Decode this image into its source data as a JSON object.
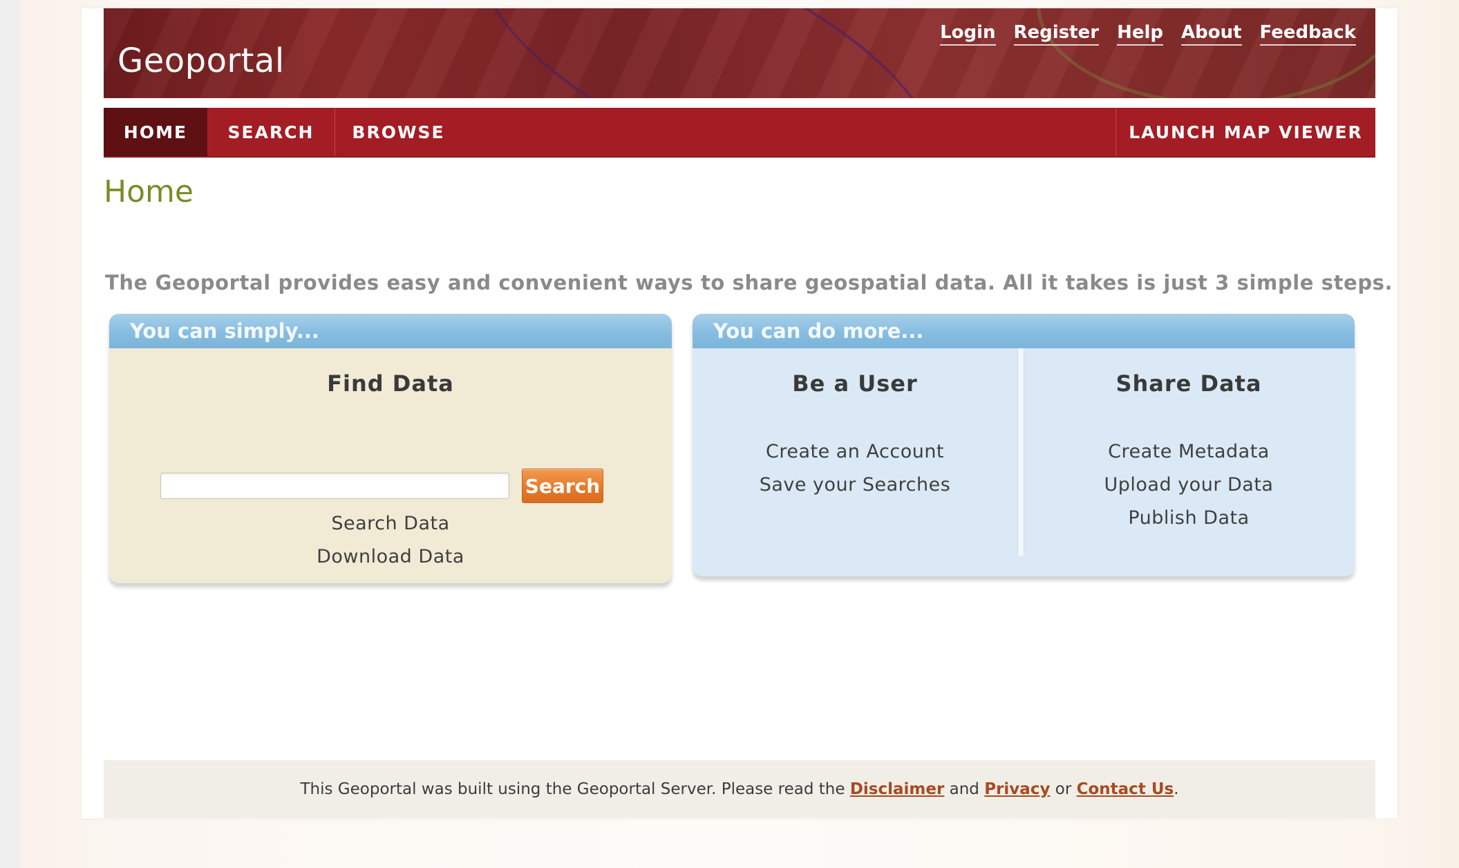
{
  "header": {
    "site_title": "Geoportal",
    "top_links": [
      "Login",
      "Register",
      "Help",
      "About",
      "Feedback"
    ]
  },
  "nav": {
    "home": "HOME",
    "search": "SEARCH",
    "browse": "BROWSE",
    "launch": "LAUNCH MAP VIEWER"
  },
  "page": {
    "title": "Home",
    "intro": "The Geoportal provides easy and convenient ways to share geospatial data. All it takes is just 3 simple steps."
  },
  "panel_left": {
    "header": "You can simply...",
    "find_title": "Find Data",
    "search_placeholder": "",
    "search_button": "Search",
    "links": [
      "Search Data",
      "Download Data"
    ]
  },
  "panel_right": {
    "header": "You can do more...",
    "user_title": "Be a User",
    "user_links": [
      "Create an Account",
      "Save your Searches"
    ],
    "share_title": "Share Data",
    "share_links": [
      "Create Metadata",
      "Upload your Data",
      "Publish Data"
    ]
  },
  "footer": {
    "text_before": "This Geoportal was built using the Geoportal Server. Please read the",
    "disclaimer": "Disclaimer",
    "and": "and",
    "privacy": "Privacy",
    "or": "or",
    "contact": "Contact Us",
    "period": "."
  },
  "colors": {
    "banner": "#7a2426",
    "nav": "#a41d24",
    "nav_active": "#5e1013",
    "title_green": "#7c8b25",
    "panel_header_blue": "#86bde1",
    "search_orange": "#e3792a"
  }
}
